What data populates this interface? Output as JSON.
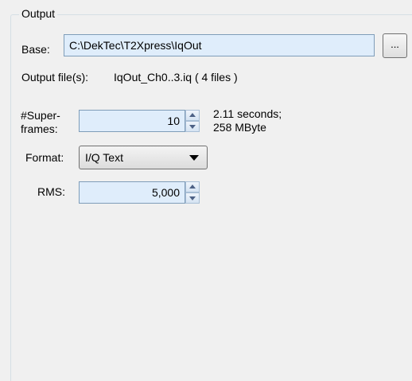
{
  "group": {
    "title": "Output"
  },
  "base": {
    "label": "Base:",
    "value": "C:\\DekTec\\T2Xpress\\IqOut",
    "browse_label": "..."
  },
  "output_files": {
    "label": "Output file(s):",
    "value": "IqOut_Ch0..3.iq ( 4 files )"
  },
  "superframes": {
    "label_line1": "#Super-",
    "label_line2": "frames:",
    "value": "10",
    "info_line1": "2.11 seconds;",
    "info_line2": "258 MByte"
  },
  "format": {
    "label": "Format:",
    "selected": "I/Q Text"
  },
  "rms": {
    "label": "RMS:",
    "value": "5,000"
  }
}
